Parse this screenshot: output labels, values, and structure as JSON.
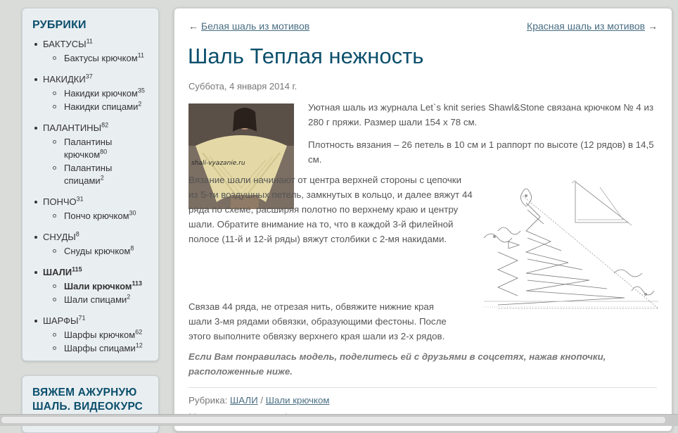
{
  "sidebar": {
    "title": "РУБРИКИ",
    "categories": [
      {
        "label": "БАКТУСЫ",
        "count": "11",
        "children": [
          {
            "label": "Бактусы крючком",
            "count": "11"
          }
        ]
      },
      {
        "label": "НАКИДКИ",
        "count": "37",
        "children": [
          {
            "label": "Накидки крючком",
            "count": "35"
          },
          {
            "label": "Накидки спицами",
            "count": "2"
          }
        ]
      },
      {
        "label": "ПАЛАНТИНЫ",
        "count": "82",
        "children": [
          {
            "label": "Палантины крючком",
            "count": "80"
          },
          {
            "label": "Палантины спицами",
            "count": "2"
          }
        ]
      },
      {
        "label": "ПОНЧО",
        "count": "31",
        "children": [
          {
            "label": "Пончо крючком",
            "count": "30"
          }
        ]
      },
      {
        "label": "СНУДЫ",
        "count": "8",
        "children": [
          {
            "label": "Снуды крючком",
            "count": "8"
          }
        ]
      },
      {
        "label": "ШАЛИ",
        "count": "115",
        "children": [
          {
            "label": "Шали крючком",
            "count": "113"
          },
          {
            "label": "Шали спицами",
            "count": "2"
          }
        ]
      },
      {
        "label": "ШАРФЫ",
        "count": "71",
        "children": [
          {
            "label": "Шарфы крючком",
            "count": "62"
          },
          {
            "label": "Шарфы спицами",
            "count": "12"
          }
        ]
      }
    ],
    "video_title": "ВЯЖЕМ АЖУРНУЮ ШАЛЬ. ВИДЕОКУРС"
  },
  "post": {
    "prev_arrow": "←",
    "prev_link": "Белая шаль из мотивов",
    "next_link": "Красная шаль из мотивов",
    "next_arrow": "→",
    "title": "Шаль Теплая нежность",
    "date": "Суббота, 4 января 2014 г.",
    "photo_watermark": "shali-vyazanie.ru",
    "p1": "Уютная шаль из журнала Let`s knit series Shawl&Stone связана крючком № 4 из 280 г пряжи. Размер шали 154 х 78 см.",
    "p2": "Плотность вязания – 26 петель в 10 см и 1 раппорт по высоте (12 рядов) в 14,5 см.",
    "p3": "Вязание шали начинают от центра верхней стороны с цепочки из 5-ти воздушных петель, замкнутых в кольцо, и далее вяжут 44 ряда по схеме, расширяя полотно по верхнему краю и центру шали. Обратите внимание на то, что в каждой 3-й филейной полосе (11-й и 12-й ряды) вяжут столбики с 2-мя накидами.",
    "p4": "Связав 44 ряда, не отрезая нить, обвяжите нижние края шали 3-мя рядами обвязки, образующими фестоны. После этого выполните обвязку верхнего края шали из 2-х рядов.",
    "p5": "Если Вам понравилась модель, поделитесь ей с друзьями в соцсетях, нажав кнопочки, расположенные ниже.",
    "rubric_label": "Рубрика:",
    "rubric_cat": "ШАЛИ",
    "rubric_sep": "/",
    "rubric_sub": "Шали крючком",
    "tags_line": "Метки: ажурная шаль | теплая шаль"
  },
  "colors": {
    "title": "#0b4f6c",
    "link": "#4a6e83",
    "sidebar_bg": "#e9eef1",
    "page_bg": "#d9dcd9"
  }
}
